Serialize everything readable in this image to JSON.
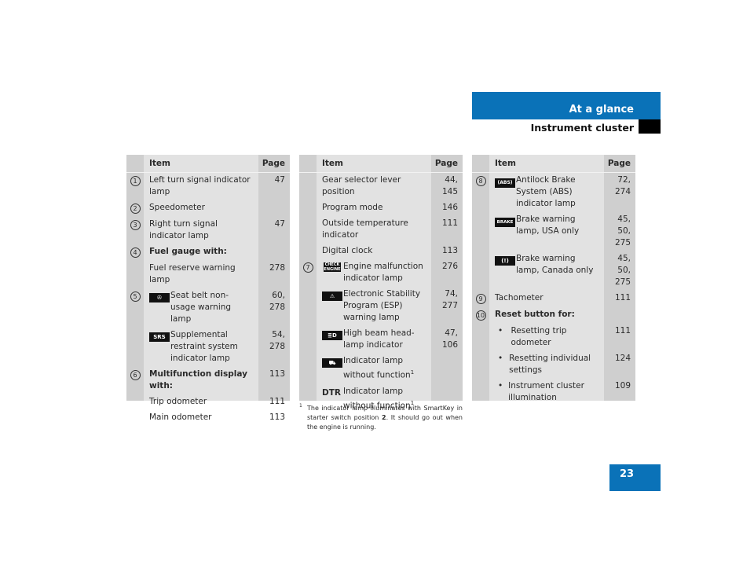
{
  "header": {
    "section": "At a glance",
    "subsection": "Instrument cluster",
    "page_number": "23",
    "accent_color": "#0a72b8"
  },
  "columns": {
    "item": "Item",
    "page": "Page"
  },
  "table1": [
    {
      "num": "1",
      "label": "Left turn signal indicator lamp",
      "page": "47"
    },
    {
      "num": "2",
      "label": "Speedometer",
      "page": ""
    },
    {
      "num": "3",
      "label": "Right turn signal indicator lamp",
      "page": "47"
    },
    {
      "num": "4",
      "label": "Fuel gauge with:",
      "page": "",
      "bold": true
    },
    {
      "num": "",
      "label": "Fuel reserve warning lamp",
      "page": "278"
    },
    {
      "num": "5",
      "icon": "seat-belt-icon",
      "icon_text": "✇",
      "label": "Seat belt non-usage warning lamp",
      "page": "60, 278"
    },
    {
      "num": "",
      "icon": "srs-icon",
      "icon_text": "SRS",
      "label": "Supplemental restraint system indicator lamp",
      "page": "54, 278"
    },
    {
      "num": "6",
      "label": "Multifunction display with:",
      "page": "113",
      "bold": true
    },
    {
      "num": "",
      "label": "Trip odometer",
      "page": "111"
    },
    {
      "num": "",
      "label": "Main odometer",
      "page": "113"
    }
  ],
  "table2": [
    {
      "num": "",
      "label": "Gear selector lever position",
      "page": "44, 145"
    },
    {
      "num": "",
      "label": "Program mode",
      "page": "146"
    },
    {
      "num": "",
      "label": "Outside temperature indicator",
      "page": "111"
    },
    {
      "num": "",
      "label": "Digital clock",
      "page": "113"
    },
    {
      "num": "7",
      "icon": "check-engine-icon",
      "icon_text": "CHECK ENGINE",
      "label": "Engine malfunction indicator lamp",
      "page": "276"
    },
    {
      "num": "",
      "icon": "warning-triangle-icon",
      "icon_text": "⚠",
      "label": "Electronic Stability Program (ESP) warning lamp",
      "page": "74, 277"
    },
    {
      "num": "",
      "icon": "high-beam-icon",
      "icon_text": "≣D",
      "label": "High beam head-lamp indicator",
      "page": "47, 106"
    },
    {
      "num": "",
      "icon": "vehicle-distance-icon",
      "icon_text": "⛟",
      "label": "Indicator lamp without function",
      "sup": "1",
      "page": ""
    },
    {
      "num": "",
      "icon": "dtr-icon",
      "icon_text": "DTR",
      "label": "Indicator lamp without function",
      "sup": "1",
      "page": ""
    }
  ],
  "footnote": {
    "mark": "1",
    "text_before": "The indicator lamp illuminates with SmartKey in starter switch position ",
    "bold": "2",
    "text_after": ". It should go out when the engine is running."
  },
  "table3": [
    {
      "num": "8",
      "icon": "abs-icon",
      "icon_text": "(ABS)",
      "label": "Antilock Brake System (ABS) indicator lamp",
      "page": "72, 274"
    },
    {
      "num": "",
      "icon": "brake-icon",
      "icon_text": "BRAKE",
      "label": "Brake warning lamp, USA only",
      "page": "45, 50, 275"
    },
    {
      "num": "",
      "icon": "brake-canada-icon",
      "icon_text": "(!)",
      "label": "Brake warning lamp, Canada only",
      "page": "45, 50, 275"
    },
    {
      "num": "9",
      "label": "Tachometer",
      "page": "111"
    },
    {
      "num": "10",
      "label": "Reset button for:",
      "page": "",
      "bold": true
    },
    {
      "num": "",
      "bullet": true,
      "label": "Resetting trip odometer",
      "page": "111"
    },
    {
      "num": "",
      "bullet": true,
      "label": "Resetting individual settings",
      "page": "124"
    },
    {
      "num": "",
      "bullet": true,
      "label": "Instrument cluster illumination",
      "page": "109"
    }
  ]
}
